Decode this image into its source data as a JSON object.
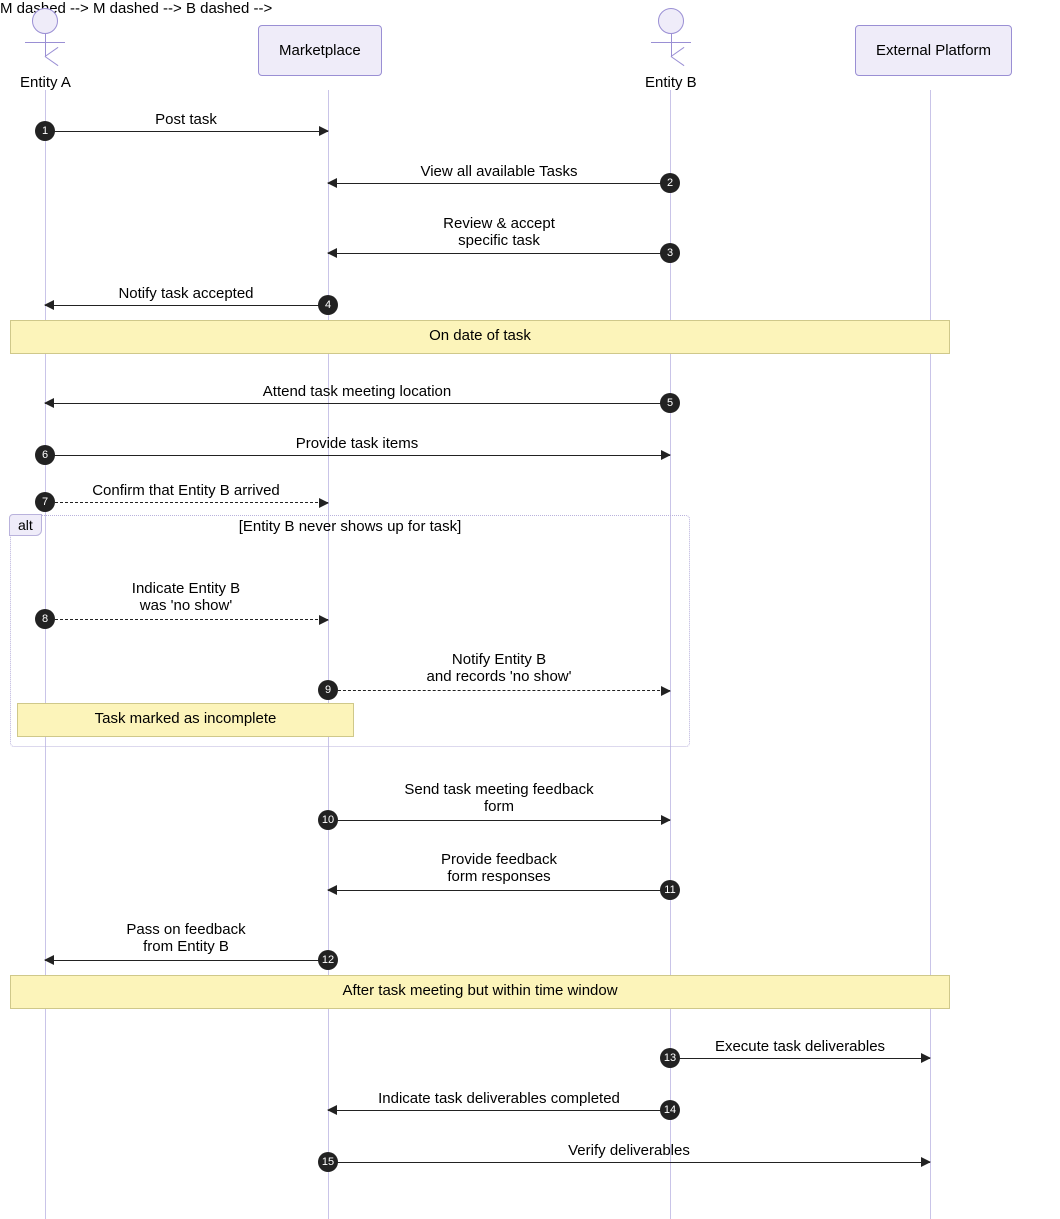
{
  "actors": {
    "entityA": {
      "label": "Entity A"
    },
    "marketplace": {
      "label": "Marketplace"
    },
    "entityB": {
      "label": "Entity B"
    },
    "external": {
      "label": "External Platform"
    }
  },
  "alt": {
    "tag": "alt",
    "guard": "[Entity B never shows up for task]"
  },
  "dividers": {
    "d1": "On date of task",
    "d2": "After task meeting but within time window"
  },
  "notes": {
    "incomplete": "Task marked as incomplete"
  },
  "messages": {
    "m1": {
      "n": "1",
      "text": "Post task"
    },
    "m2": {
      "n": "2",
      "text": "View all available Tasks"
    },
    "m3": {
      "n": "3",
      "text": "Review & accept\nspecific task"
    },
    "m4": {
      "n": "4",
      "text": "Notify task accepted"
    },
    "m5": {
      "n": "5",
      "text": "Attend task meeting location"
    },
    "m6": {
      "n": "6",
      "text": "Provide task items"
    },
    "m7": {
      "n": "7",
      "text": "Confirm that Entity B arrived"
    },
    "m8": {
      "n": "8",
      "text": "Indicate Entity B\nwas 'no show'"
    },
    "m9": {
      "n": "9",
      "text": "Notify Entity B\nand records 'no show'"
    },
    "m10": {
      "n": "10",
      "text": "Send task meeting feedback\nform"
    },
    "m11": {
      "n": "11",
      "text": "Provide feedback\nform responses"
    },
    "m12": {
      "n": "12",
      "text": "Pass on feedback\nfrom Entity B"
    },
    "m13": {
      "n": "13",
      "text": "Execute task deliverables"
    },
    "m14": {
      "n": "14",
      "text": "Indicate task deliverables completed"
    },
    "m15": {
      "n": "15",
      "text": "Verify deliverables"
    }
  },
  "chart_data": {
    "type": "sequence-diagram",
    "participants": [
      {
        "id": "A",
        "name": "Entity A",
        "kind": "actor"
      },
      {
        "id": "M",
        "name": "Marketplace",
        "kind": "system"
      },
      {
        "id": "B",
        "name": "Entity B",
        "kind": "actor"
      },
      {
        "id": "EP",
        "name": "External Platform",
        "kind": "system"
      }
    ],
    "events": [
      {
        "n": 1,
        "from": "A",
        "to": "M",
        "label": "Post task",
        "style": "sync"
      },
      {
        "n": 2,
        "from": "B",
        "to": "M",
        "label": "View all available Tasks",
        "style": "sync"
      },
      {
        "n": 3,
        "from": "B",
        "to": "M",
        "label": "Review & accept specific task",
        "style": "sync"
      },
      {
        "n": 4,
        "from": "M",
        "to": "A",
        "label": "Notify task accepted",
        "style": "sync"
      },
      {
        "divider": "On date of task"
      },
      {
        "n": 5,
        "from": "B",
        "to": "A",
        "label": "Attend task meeting location",
        "style": "sync"
      },
      {
        "n": 6,
        "from": "A",
        "to": "B",
        "label": "Provide task items",
        "style": "sync"
      },
      {
        "n": 7,
        "from": "A",
        "to": "M",
        "label": "Confirm that Entity B arrived",
        "style": "async"
      },
      {
        "alt_begin": "[Entity B never shows up for task]"
      },
      {
        "n": 8,
        "from": "A",
        "to": "M",
        "label": "Indicate Entity B was 'no show'",
        "style": "async"
      },
      {
        "n": 9,
        "from": "M",
        "to": "B",
        "label": "Notify Entity B and records 'no show'",
        "style": "async"
      },
      {
        "note": "Task marked as incomplete",
        "over": [
          "A",
          "M"
        ]
      },
      {
        "alt_end": true
      },
      {
        "n": 10,
        "from": "M",
        "to": "B",
        "label": "Send task meeting feedback form",
        "style": "sync"
      },
      {
        "n": 11,
        "from": "B",
        "to": "M",
        "label": "Provide feedback form responses",
        "style": "sync"
      },
      {
        "n": 12,
        "from": "M",
        "to": "A",
        "label": "Pass on feedback from Entity B",
        "style": "sync"
      },
      {
        "divider": "After task meeting but within time window"
      },
      {
        "n": 13,
        "from": "B",
        "to": "EP",
        "label": "Execute task deliverables",
        "style": "sync"
      },
      {
        "n": 14,
        "from": "B",
        "to": "M",
        "label": "Indicate task deliverables completed",
        "style": "sync"
      },
      {
        "n": 15,
        "from": "M",
        "to": "EP",
        "label": "Verify deliverables",
        "style": "sync"
      }
    ]
  }
}
